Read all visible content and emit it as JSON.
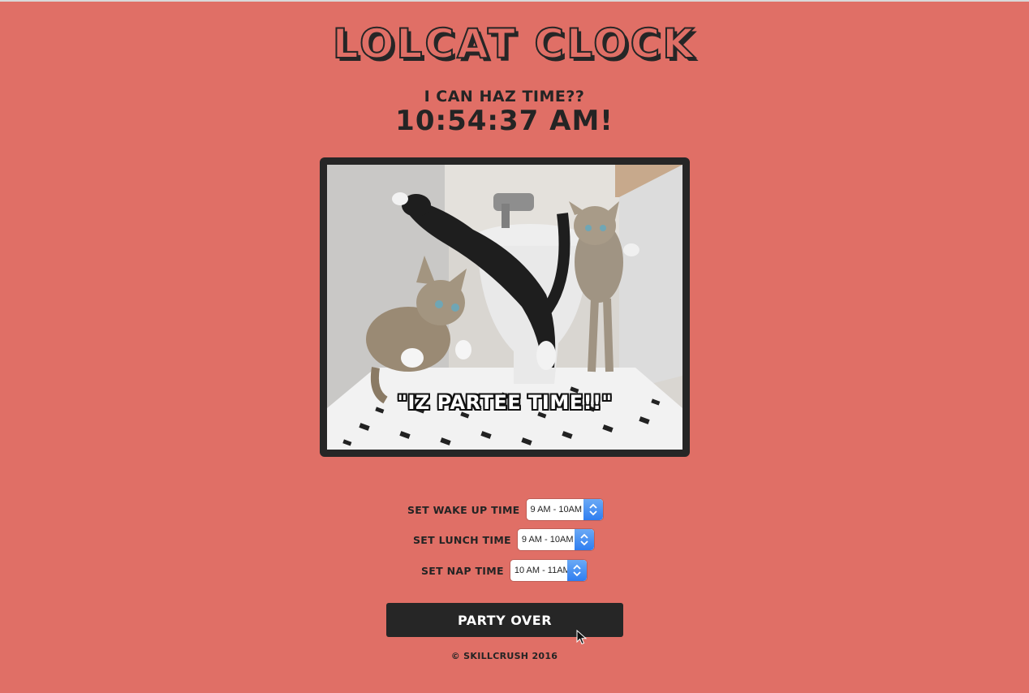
{
  "title": "LOLCAT CLOCK",
  "clock": {
    "prompt": "I CAN HAZ TIME??",
    "time": "10:54:37 AM!"
  },
  "image": {
    "caption": "\"IZ PARTEE TIME!!\"",
    "alt_subject": "three kittens playing in a bathroom"
  },
  "controls": [
    {
      "label": "SET WAKE UP TIME",
      "selected": "9 AM - 10AM"
    },
    {
      "label": "SET LUNCH TIME",
      "selected": "9 AM - 10AM"
    },
    {
      "label": "SET NAP TIME",
      "selected": "10 AM - 11AM"
    }
  ],
  "button": {
    "label": "PARTY OVER"
  },
  "footer": "© SKILLCRUSH 2016",
  "colors": {
    "background": "#e06f66",
    "dark": "#262626",
    "select_arrow": "#2f7ef0"
  },
  "icons": [
    "chevron-up-down-icon",
    "mouse-pointer-icon"
  ]
}
